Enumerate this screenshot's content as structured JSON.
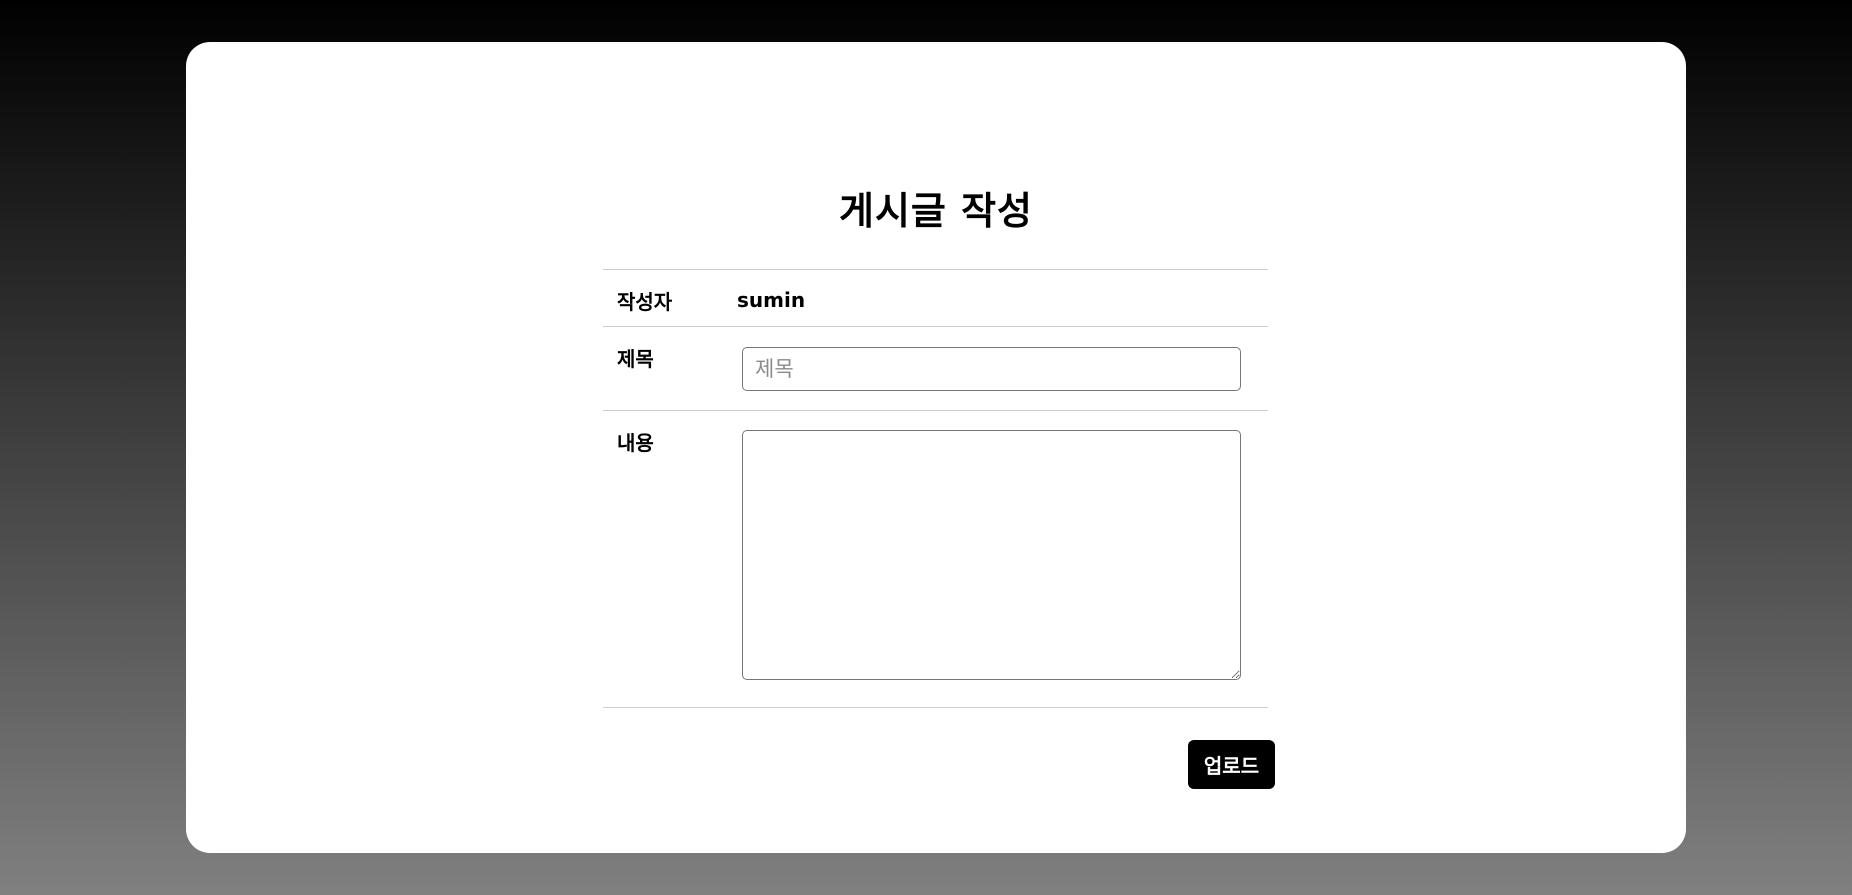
{
  "page": {
    "title": "게시글 작성"
  },
  "form": {
    "author": {
      "label": "작성자",
      "value": "sumin"
    },
    "title": {
      "label": "제목",
      "value": "",
      "placeholder": "제목"
    },
    "content": {
      "label": "내용",
      "value": ""
    },
    "submit_label": "업로드"
  },
  "colors": {
    "background_top": "#000000",
    "background_bottom": "#808080",
    "card": "#ffffff",
    "button": "#000000",
    "button_text": "#ffffff"
  }
}
